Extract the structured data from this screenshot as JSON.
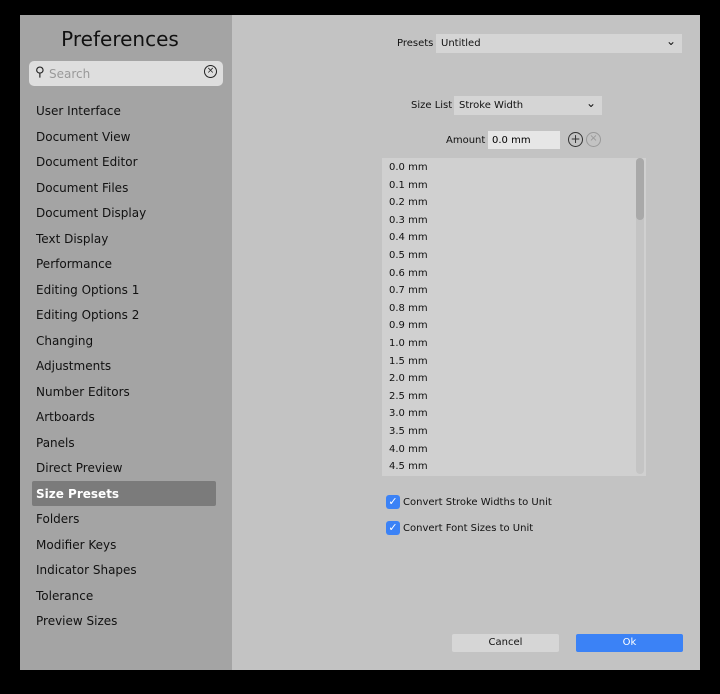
{
  "sidebar": {
    "title": "Preferences",
    "search_placeholder": "Search",
    "items": [
      "User Interface",
      "Document View",
      "Document Editor",
      "Document Files",
      "Document Display",
      "Text Display",
      "Performance",
      "Editing Options 1",
      "Editing Options 2",
      "Changing",
      "Adjustments",
      "Number Editors",
      "Artboards",
      "Panels",
      "Direct Preview",
      "Size Presets",
      "Folders",
      "Modifier Keys",
      "Indicator Shapes",
      "Tolerance",
      "Preview Sizes"
    ],
    "selected": "Size Presets"
  },
  "main": {
    "presets_label": "Presets",
    "presets_value": "Untitled",
    "size_list_label": "Size List",
    "size_list_value": "Stroke Width",
    "amount_label": "Amount",
    "amount_value": "0.0 mm",
    "sizes": [
      "0.0 mm",
      "0.1 mm",
      "0.2 mm",
      "0.3 mm",
      "0.4 mm",
      "0.5 mm",
      "0.6 mm",
      "0.7 mm",
      "0.8 mm",
      "0.9 mm",
      "1.0 mm",
      "1.5 mm",
      "2.0 mm",
      "2.5 mm",
      "3.0 mm",
      "3.5 mm",
      "4.0 mm",
      "4.5 mm"
    ],
    "checkboxes": [
      {
        "label": "Convert Stroke Widths to Unit",
        "checked": true
      },
      {
        "label": "Convert Font Sizes to Unit",
        "checked": true
      }
    ],
    "cancel": "Cancel",
    "ok": "Ok"
  },
  "colors": {
    "accent": "#3b82f6"
  }
}
